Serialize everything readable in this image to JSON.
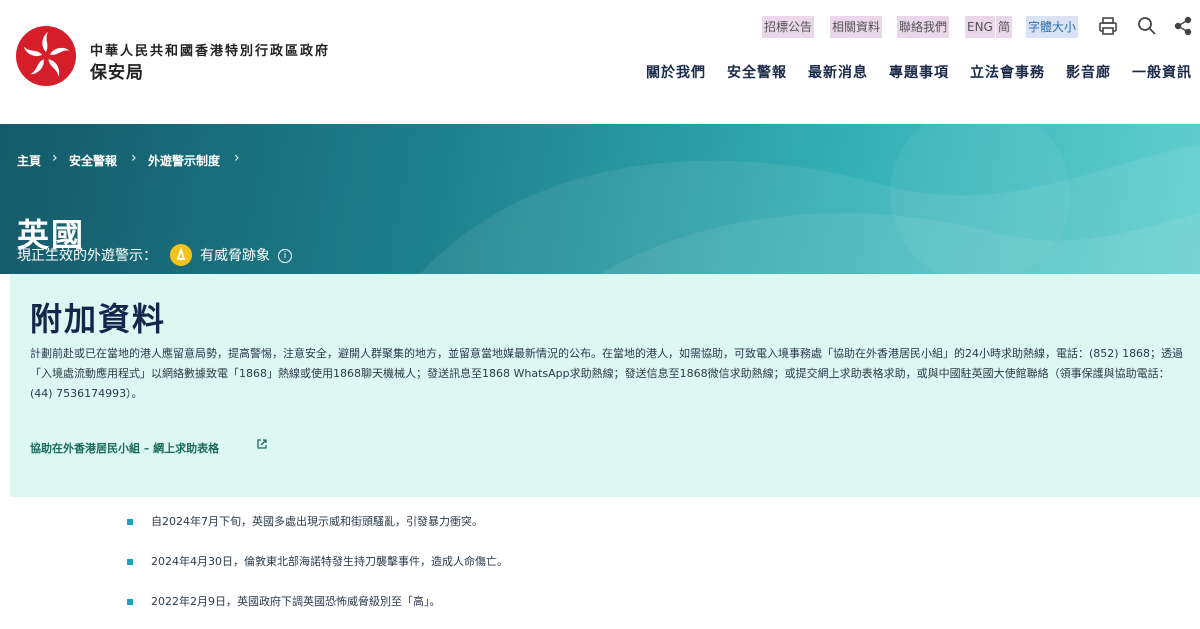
{
  "header": {
    "org_top": "中華人民共和國香港特別行政區政府",
    "org_name": "保安局",
    "utility_links": [
      "招標公告",
      "相關資料",
      "聯絡我們",
      "ENG",
      "简",
      "字體大小"
    ],
    "nav": [
      "關於我們",
      "安全警報",
      "最新消息",
      "專題事項",
      "立法會事務",
      "影音廊",
      "一般資訊"
    ]
  },
  "breadcrumb": [
    "主頁",
    "安全警報",
    "外遊警示制度"
  ],
  "hero": {
    "title": "英國",
    "alert_label": "現正生效的外遊警示：",
    "alert_level": "有威脅跡象",
    "alert_color": "#f2c31b"
  },
  "additional_info": {
    "title": "附加資料",
    "body": "計劃前赴或已在當地的港人應留意局勢，提高警惕，注意安全，避開人群聚集的地方，並留意當地媒最新情況的公布。在當地的港人，如需協助，可致電入境事務處「協助在外香港居民小組」的24小時求助熱線，電話：(852) 1868；透過「入境處流動應用程式」以網絡數據致電「1868」熱線或使用1868聊天機械人；發送訊息至1868 WhatsApp求助熱線；發送信息至1868微信求助熱線；或提交網上求助表格求助，或與中國駐英國大使館聯絡（領事保護與協助電話：(44) 7536174993）。",
    "link_text": "協助在外香港居民小組 – 網上求助表格"
  },
  "events": [
    "自2024年7月下旬，英國多處出現示威和街頭騷亂，引發暴力衝突。",
    "2024年4月30日，倫敦東北部海諾特發生持刀襲擊事件，造成人命傷亡。",
    "2022年2月9日，英國政府下調英國恐怖威脅級別至「高」。"
  ]
}
